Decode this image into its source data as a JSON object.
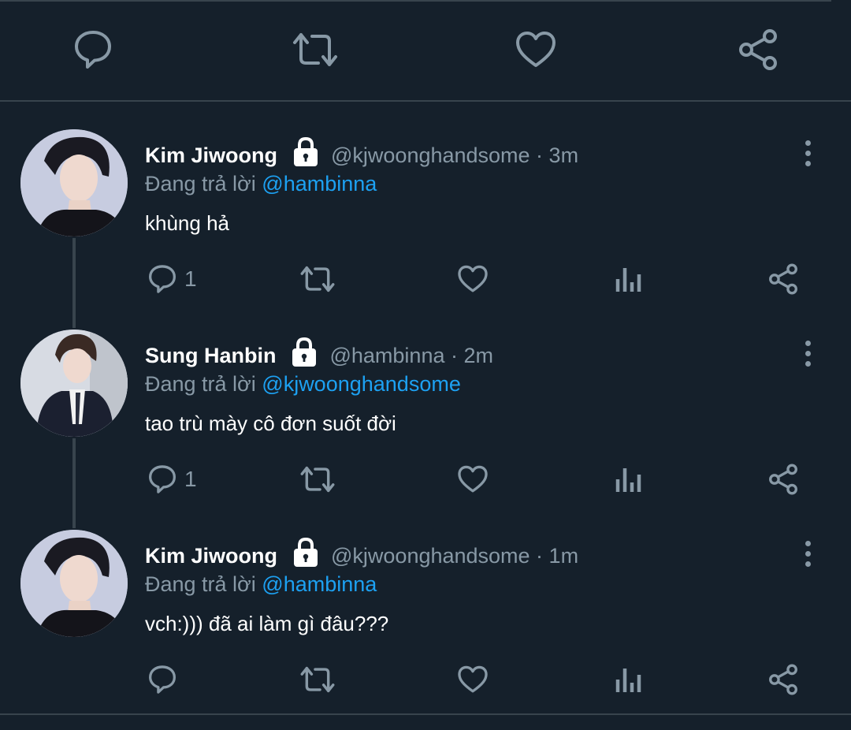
{
  "colors": {
    "background": "#15202b",
    "divider": "#38444d",
    "icon": "#8899a6",
    "link": "#1da1f2"
  },
  "top_actions": [
    "reply-icon",
    "retweet-icon",
    "like-icon",
    "share-icon"
  ],
  "tweets": [
    {
      "name": "Kim Jiwoong",
      "handle": "@kjwoonghandsome · 3m",
      "replying_prefix": "Đang trả lời",
      "replying_to": "@hambinna",
      "text": "khùng hả",
      "reply_count": "1",
      "locked": true
    },
    {
      "name": "Sung Hanbin",
      "handle": "@hambinna · 2m",
      "replying_prefix": "Đang trả lời",
      "replying_to": "@kjwoonghandsome",
      "text": "tao trù mày cô đơn suốt đời",
      "reply_count": "1",
      "locked": true
    },
    {
      "name": "Kim Jiwoong",
      "handle": "@kjwoonghandsome · 1m",
      "replying_prefix": "Đang trả lời",
      "replying_to": "@hambinna",
      "text": "vch:))) đã ai làm gì đâu???",
      "reply_count": "",
      "locked": true
    }
  ]
}
